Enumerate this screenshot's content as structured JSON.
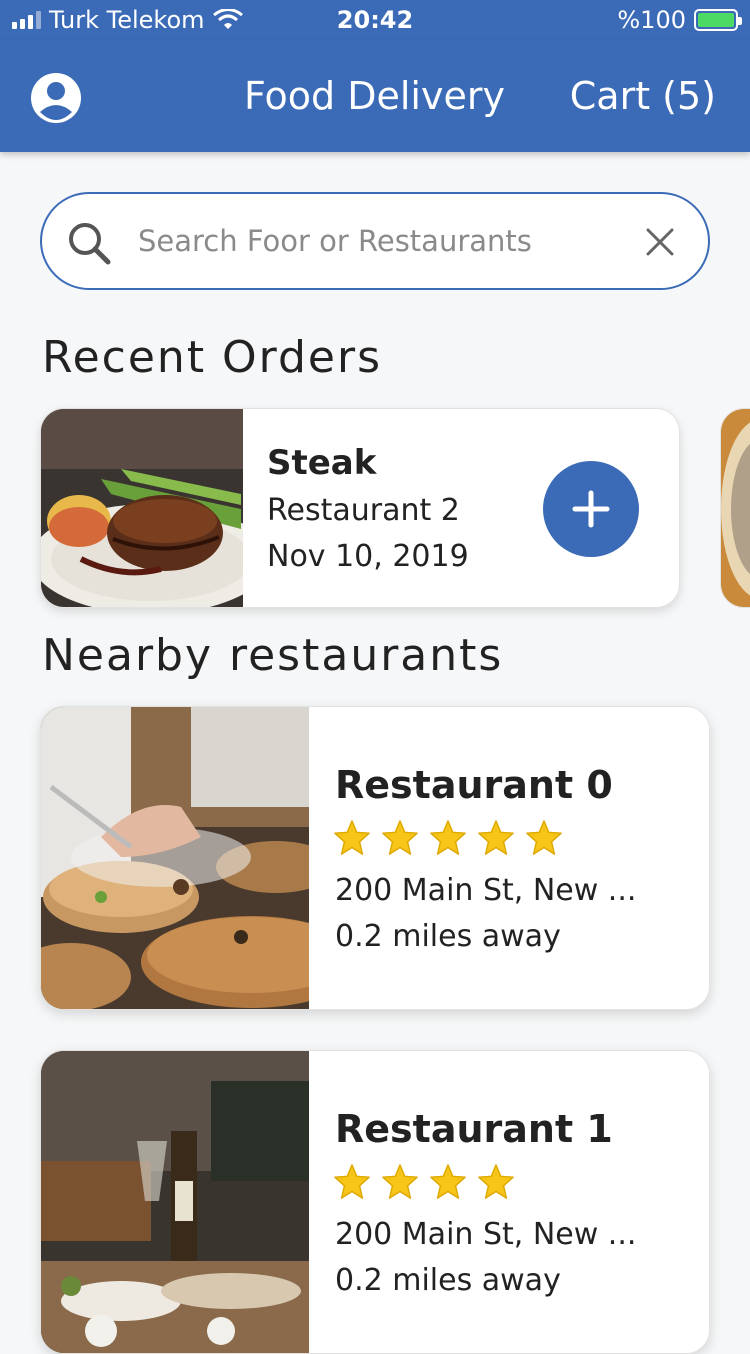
{
  "status_bar": {
    "carrier": "Turk Telekom",
    "time": "20:42",
    "battery": "%100"
  },
  "nav": {
    "title": "Food Delivery",
    "cart_label": "Cart (5)"
  },
  "search": {
    "placeholder": "Search Foor or Restaurants",
    "value": ""
  },
  "recent_orders": {
    "title": "Recent Orders",
    "items": [
      {
        "name": "Steak",
        "restaurant": "Restaurant 2",
        "date": "Nov 10, 2019"
      }
    ]
  },
  "nearby": {
    "title": "Nearby restaurants",
    "items": [
      {
        "name": "Restaurant 0",
        "rating": 5,
        "address": "200 Main St, New ...",
        "distance": "0.2 miles away"
      },
      {
        "name": "Restaurant 1",
        "rating": 4,
        "address": "200 Main St, New ...",
        "distance": "0.2 miles away"
      }
    ]
  },
  "colors": {
    "primary": "#3b6bb7",
    "star": "#f5c518",
    "battery": "#4cd964"
  },
  "icons": [
    "signal-icon",
    "wifi-icon",
    "battery-icon",
    "profile-icon",
    "search-icon",
    "close-icon",
    "plus-icon",
    "star-icon"
  ]
}
